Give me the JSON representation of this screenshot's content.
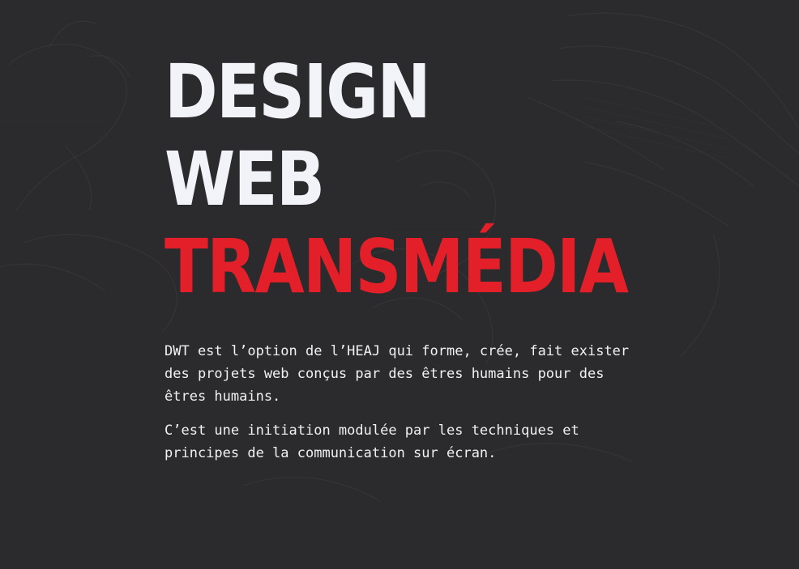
{
  "hero": {
    "line1": "DESIGN",
    "line2": "WEB",
    "line3": "TRANSMÉDIA"
  },
  "intro": {
    "paragraph1": "DWT est l’option de l’HEAJ qui forme, crée, fait exister des projets web conçus par des êtres humains pour des êtres humains.",
    "paragraph2": "C’est une initiation modulée par les techniques et principes de la communication sur écran."
  },
  "colors": {
    "background": "#2b2b2d",
    "text": "#f2f3f8",
    "accent": "#e3202a"
  }
}
